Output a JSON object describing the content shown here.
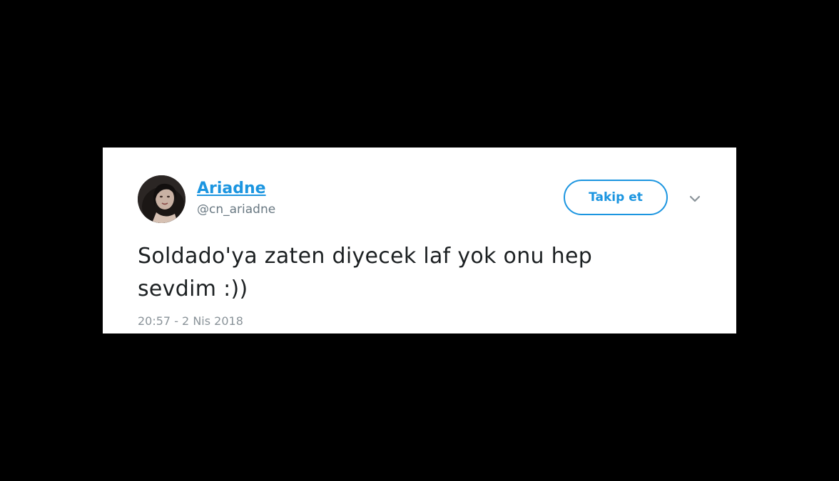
{
  "tweet": {
    "display_name": "Ariadne",
    "handle": "@cn_ariadne",
    "follow_label": "Takip et",
    "text_line1": "Soldado'ya zaten diyecek laf yok onu hep",
    "text_line2": "sevdim :))",
    "timestamp": "20:57 - 2 Nis 2018",
    "menu_icon": "chevron-down-icon",
    "accent_color": "#1b95e0"
  }
}
